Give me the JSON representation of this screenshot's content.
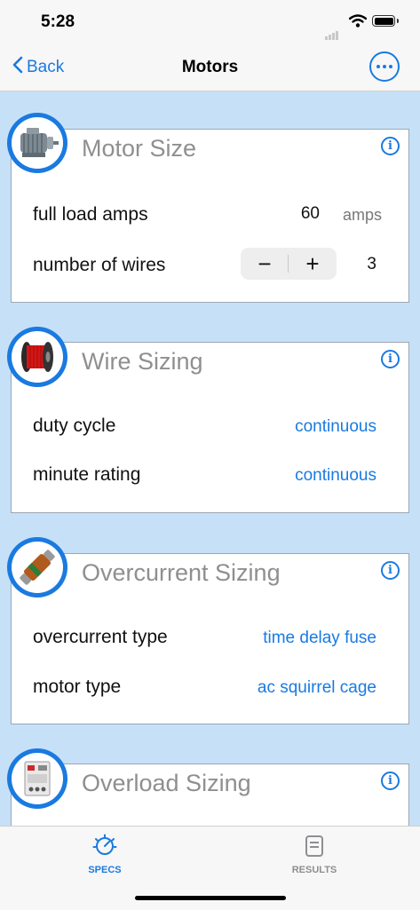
{
  "status": {
    "time": "5:28"
  },
  "nav": {
    "back_label": "Back",
    "title": "Motors"
  },
  "sections": [
    {
      "title": "Motor Size",
      "icon": "motor-icon"
    },
    {
      "title": "Wire Sizing",
      "icon": "wire-spool-icon"
    },
    {
      "title": "Overcurrent Sizing",
      "icon": "fuse-icon"
    },
    {
      "title": "Overload Sizing",
      "icon": "overload-relay-icon"
    }
  ],
  "motor_size": {
    "fla_label": "full load amps",
    "fla_value": "60",
    "fla_unit": "amps",
    "wires_label": "number of wires",
    "wires_value": "3",
    "minus": "−",
    "plus": "+"
  },
  "wire_sizing": {
    "duty_label": "duty cycle",
    "duty_value": "continuous",
    "minute_label": "minute rating",
    "minute_value": "continuous"
  },
  "overcurrent": {
    "type_label": "overcurrent type",
    "type_value": "time delay fuse",
    "motor_label": "motor type",
    "motor_value": "ac squirrel cage"
  },
  "tabs": [
    {
      "label": "SPECS",
      "icon": "specs-gauge-icon",
      "active": true,
      "color": "#1a7ae0"
    },
    {
      "label": "RESULTS",
      "icon": "results-document-icon",
      "active": false,
      "color": "#8e8e93"
    }
  ],
  "colors": {
    "accent": "#1a7ae0",
    "background": "#c6e1f7"
  }
}
